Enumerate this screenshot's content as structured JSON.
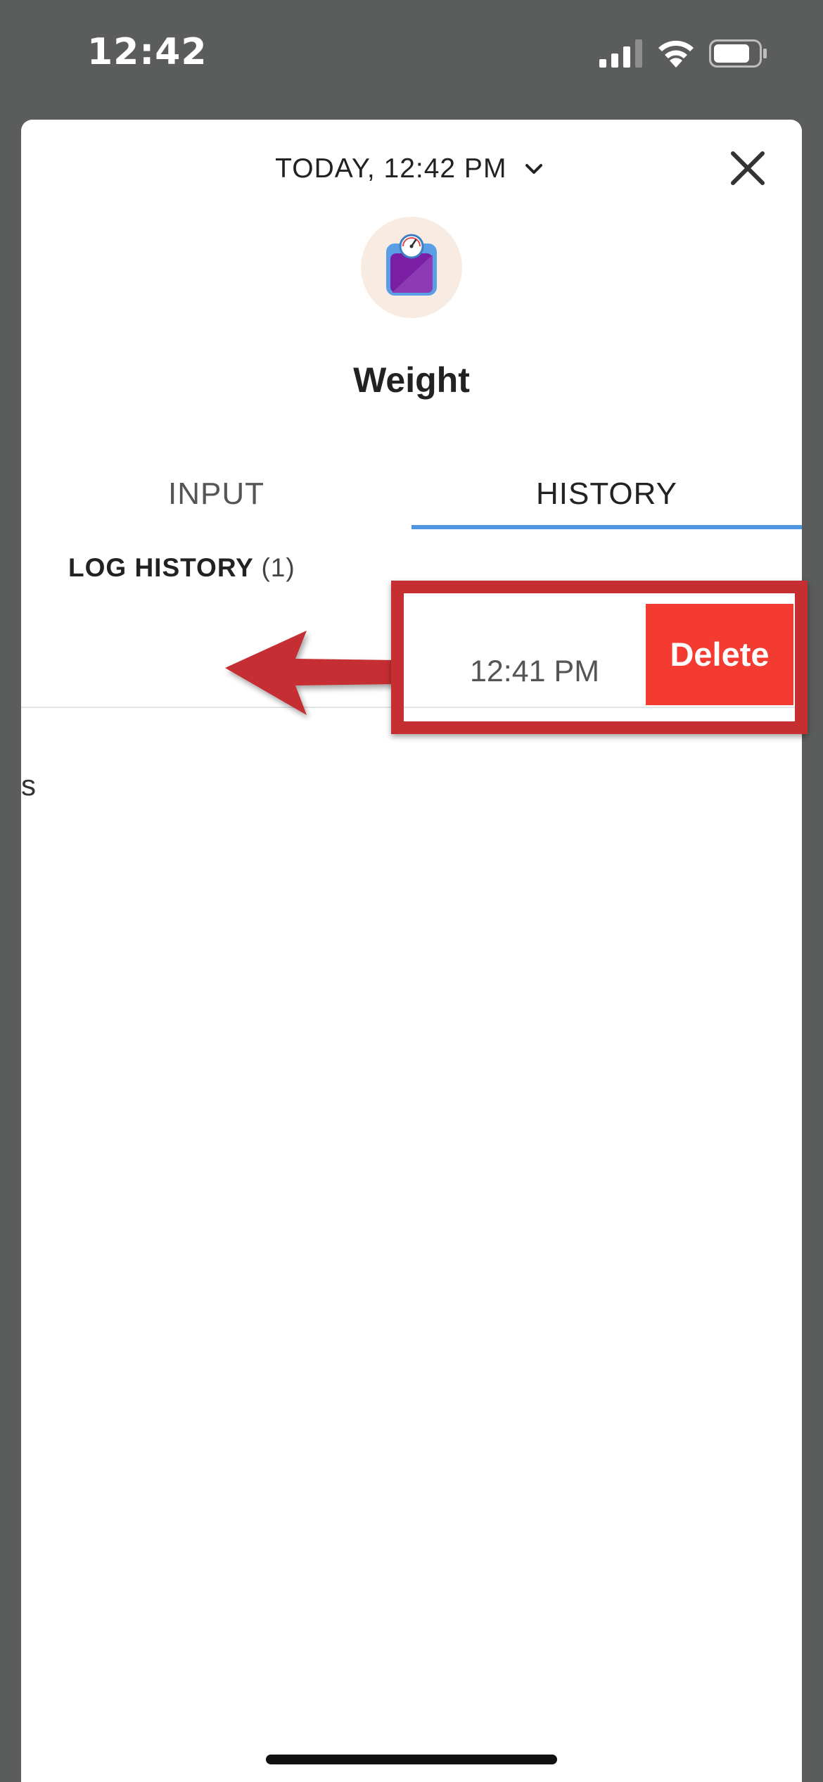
{
  "status_bar": {
    "time": "12:42"
  },
  "header": {
    "date_label": "TODAY, 12:42 PM"
  },
  "metric": {
    "title": "Weight",
    "icon": "scale-icon"
  },
  "tabs": [
    {
      "label": "INPUT",
      "selected": false
    },
    {
      "label": "HISTORY",
      "selected": true
    }
  ],
  "log_history": {
    "label": "LOG HISTORY",
    "count": "(1)"
  },
  "log_entry": {
    "left_fragment": "s",
    "time": "12:41 PM",
    "delete_label": "Delete"
  },
  "colors": {
    "delete": "#f43b31",
    "tab_underline": "#4f95e0",
    "annotation": "#c52f32",
    "icon_bg": "#f8ece2"
  }
}
